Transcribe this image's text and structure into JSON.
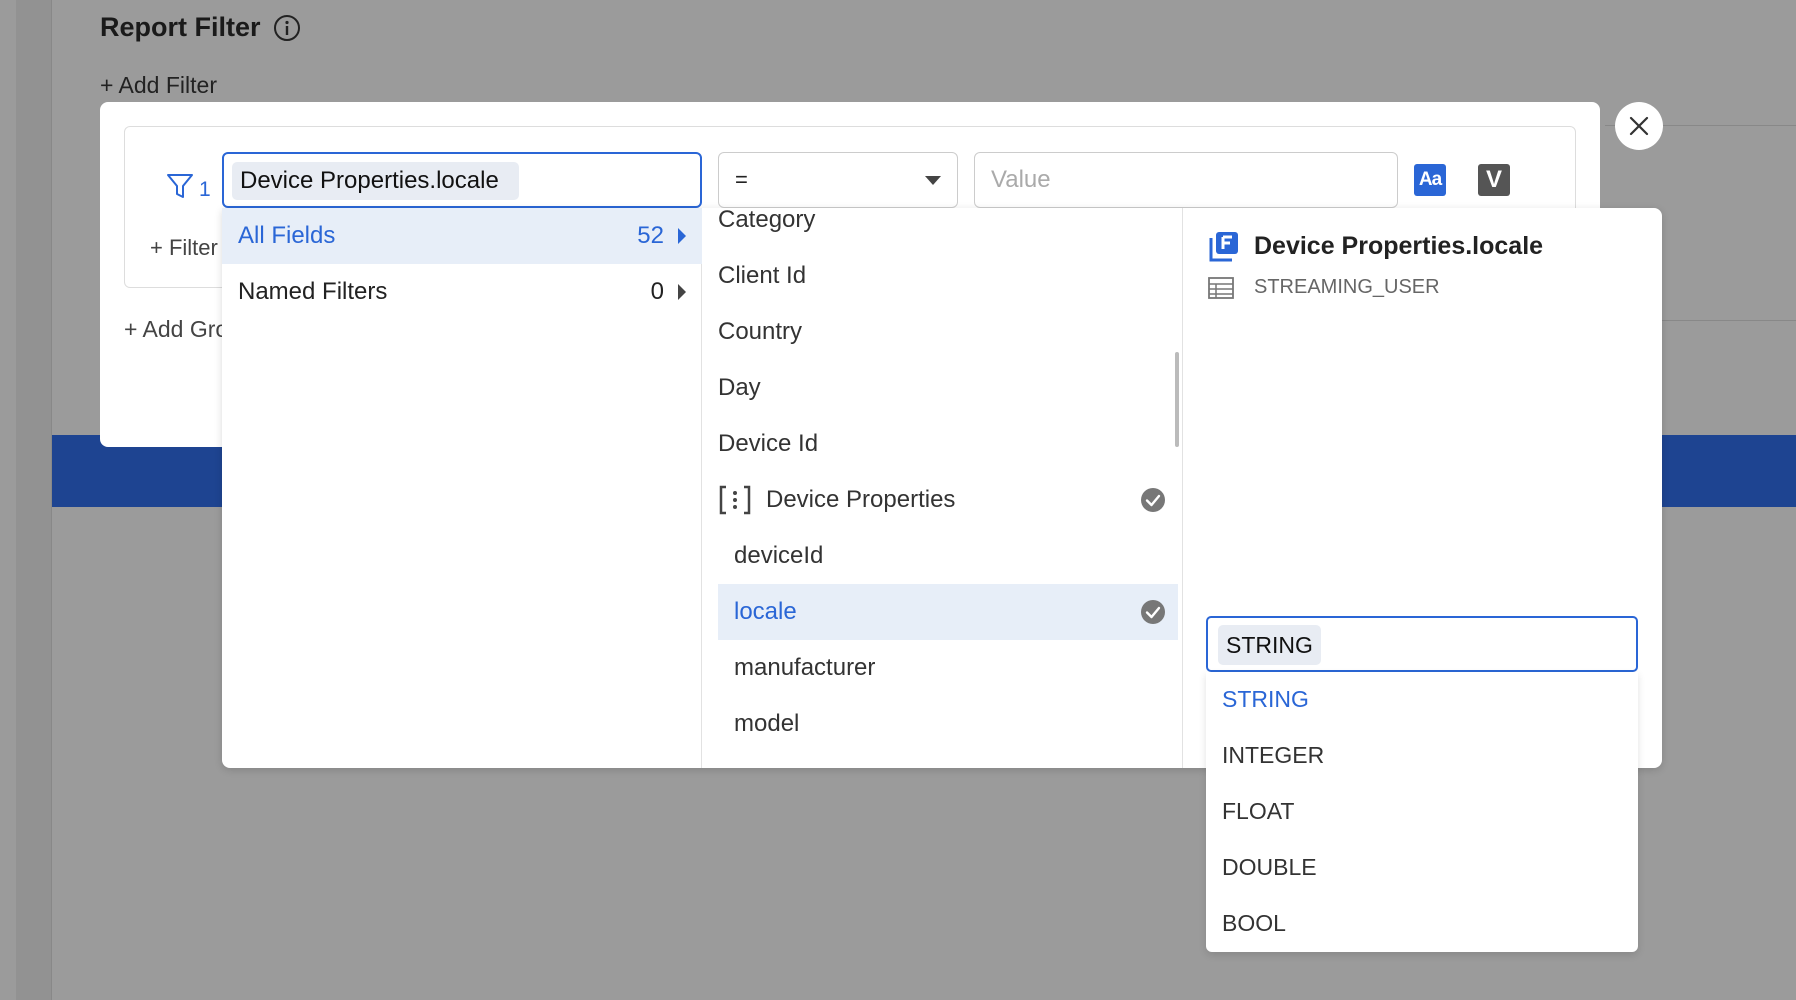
{
  "background": {
    "title": "Report Filter",
    "add_filter": "+ Add Filter"
  },
  "filter": {
    "index": "1",
    "filter_link": "+ Filter",
    "add_group": "+ Add Gro",
    "field_value": "Device Properties.locale",
    "operator": "=",
    "value_placeholder": "Value",
    "case_button": "Aa",
    "variable_button": "V"
  },
  "categories": [
    {
      "label": "All Fields",
      "count": "52",
      "active": true
    },
    {
      "label": "Named Filters",
      "count": "0",
      "active": false
    }
  ],
  "fields": [
    {
      "label": "Category"
    },
    {
      "label": "Client Id"
    },
    {
      "label": "Country"
    },
    {
      "label": "Day"
    },
    {
      "label": "Device Id"
    },
    {
      "label": "Device Properties"
    },
    {
      "label": "deviceId"
    },
    {
      "label": "locale"
    },
    {
      "label": "manufacturer"
    },
    {
      "label": "model"
    }
  ],
  "detail": {
    "field_name": "Device Properties.locale",
    "table": "STREAMING_USER"
  },
  "type_select": {
    "selected": "STRING",
    "options": [
      "STRING",
      "INTEGER",
      "FLOAT",
      "DOUBLE",
      "BOOL"
    ]
  },
  "colors": {
    "accent": "#2a66d6",
    "selected_bg": "#e7eef8",
    "overlay": "#9b9b9b",
    "bar": "#1e4491"
  }
}
